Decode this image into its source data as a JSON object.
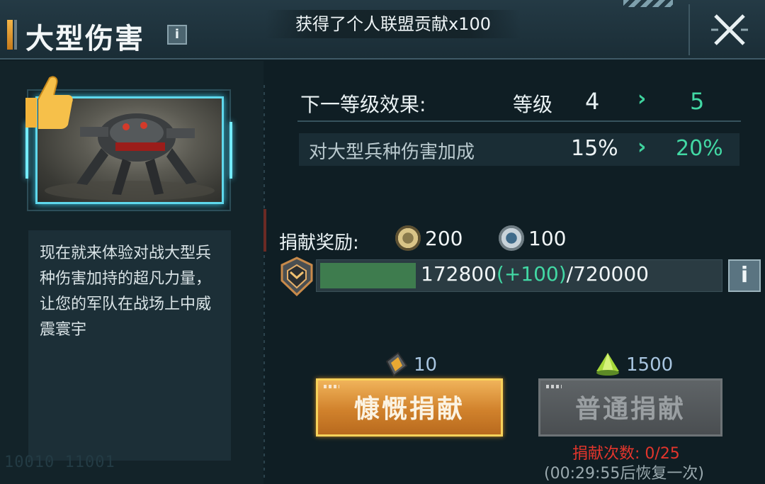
{
  "header": {
    "title": "大型伤害",
    "info_label": "i",
    "notice": "获得了个人联盟贡献x100"
  },
  "left": {
    "description": "现在就来体验对战大型兵种伤害加持的超凡力量，让您的军队在战场上中威震寰宇",
    "serial": "10010 11001"
  },
  "next_level": {
    "label": "下一等级效果:",
    "level_label": "等级",
    "current_level": "4",
    "next_level": "5",
    "arrow": "›",
    "effect_label": "对大型兵种伤害加成",
    "effect_current": "15%",
    "effect_next": "20%"
  },
  "rewards": {
    "label": "捐献奖励:",
    "items": [
      {
        "icon": "gold-medal-icon",
        "value": "200"
      },
      {
        "icon": "silver-medal-icon",
        "value": "100"
      }
    ]
  },
  "progress": {
    "current": "172800",
    "bonus": "(+100)",
    "max": "/720000",
    "fraction": 0.24,
    "info_label": "i"
  },
  "actions": {
    "generous": {
      "label": "慷慨捐献",
      "cost": "10",
      "cost_icon": "gold-crystal-icon"
    },
    "normal": {
      "label": "普通捐献",
      "cost": "1500",
      "cost_icon": "green-crystal-icon"
    },
    "donate_count": "捐献次数: 0/25",
    "recover": "(00:29:55后恢复一次)"
  },
  "colors": {
    "accent_green": "#42d8a4",
    "gold": "#d1822c",
    "warning_red": "#e2352c",
    "cyan_glow": "#5fd8ec"
  }
}
